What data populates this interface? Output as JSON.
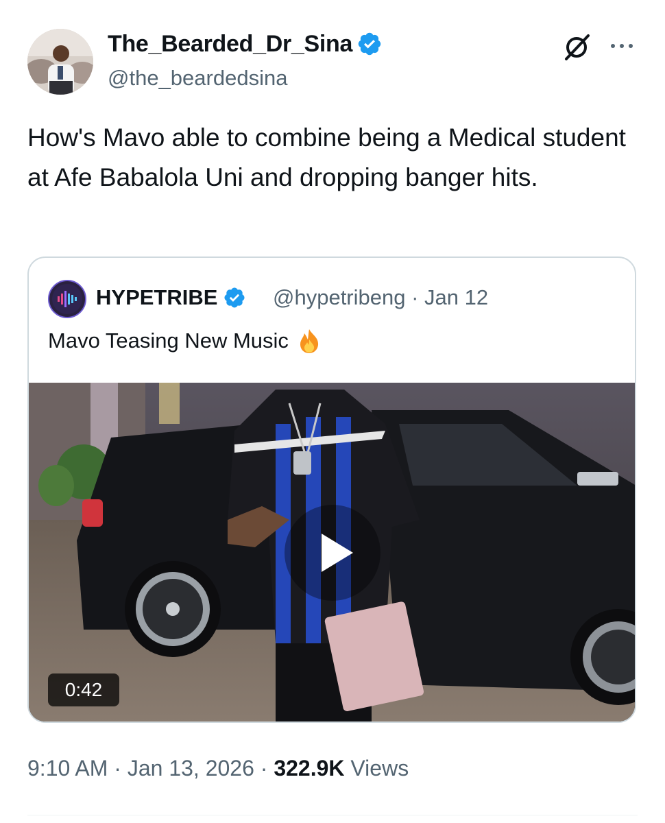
{
  "author": {
    "name": "The_Bearded_Dr_Sina",
    "handle": "@the_beardedsina",
    "verified": true
  },
  "icons": {
    "grok": "grok-icon",
    "more": "more-icon",
    "verified": "verified-badge-icon",
    "play": "play-icon"
  },
  "tweet": {
    "text": "How's Mavo able to combine being a Medical student at Afe Babalola Uni and dropping banger hits."
  },
  "quote": {
    "name": "HYPETRIBE",
    "handle": "@hypetribeng",
    "date": "Jan 12",
    "meta": "@hypetribeng · Jan 12",
    "text": "Mavo Teasing New Music",
    "emoji": "🔥",
    "video_duration": "0:42"
  },
  "footer": {
    "time": "9:10 AM",
    "date": "Jan 13, 2026",
    "views_count": "322.9K",
    "views_label": "Views"
  },
  "colors": {
    "text": "#0f1419",
    "secondary": "#536471",
    "verified": "#1d9bf0",
    "border": "#cfd9de"
  }
}
